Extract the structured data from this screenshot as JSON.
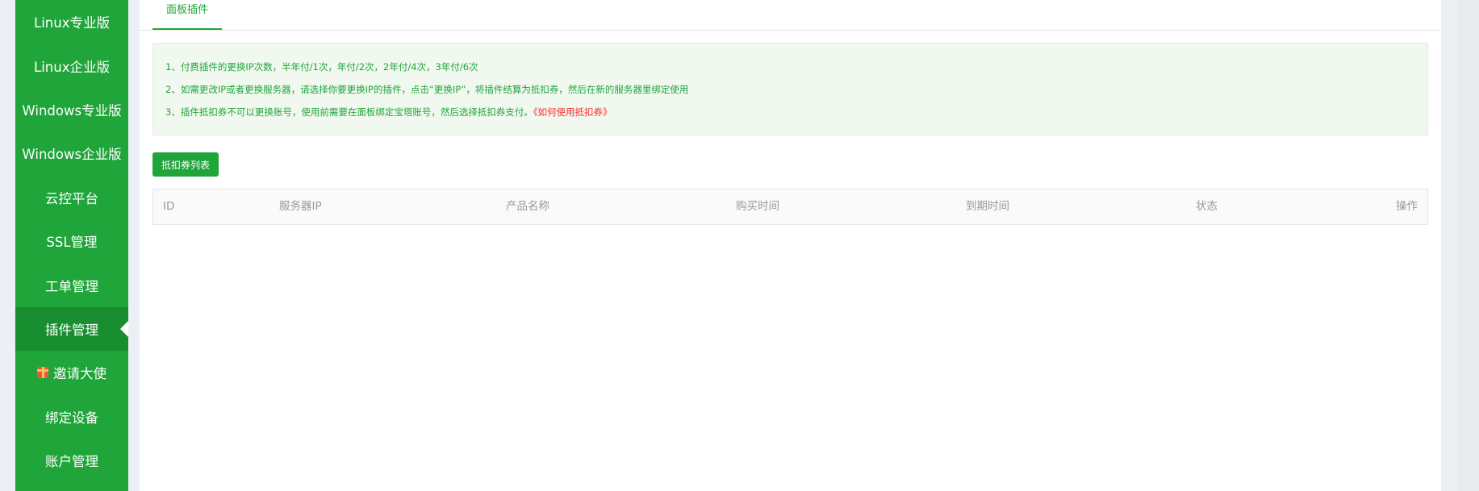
{
  "sidebar": {
    "items": [
      {
        "label": "Linux专业版"
      },
      {
        "label": "Linux企业版"
      },
      {
        "label": "Windows专业版"
      },
      {
        "label": "Windows企业版"
      },
      {
        "label": "云控平台"
      },
      {
        "label": "SSL管理"
      },
      {
        "label": "工单管理"
      },
      {
        "label": "插件管理",
        "active": true
      },
      {
        "label": "邀请大使",
        "icon": "gift-icon"
      },
      {
        "label": "绑定设备"
      },
      {
        "label": "账户管理"
      }
    ]
  },
  "main": {
    "tabs": [
      {
        "label": "面板插件",
        "active": true
      }
    ],
    "notice": {
      "lines": [
        "1、付费插件的更换IP次数，半年付/1次，年付/2次，2年付/4次，3年付/6次",
        "2、如需更改IP或者更换服务器，请选择你要更换IP的插件，点击“更换IP”，将插件结算为抵扣券，然后在新的服务器里绑定使用",
        "3、插件抵扣券不可以更换账号，使用前需要在面板绑定宝塔账号，然后选择抵扣券支付。"
      ],
      "link": "《如何使用抵扣券》"
    },
    "coupon_button": "抵扣券列表",
    "table": {
      "columns": [
        "ID",
        "服务器IP",
        "产品名称",
        "购买时间",
        "到期时间",
        "状态",
        "操作"
      ],
      "rows": []
    }
  },
  "colors": {
    "brand_green": "#20a53a",
    "active_green": "#188e31",
    "notice_bg": "#f1f8f0",
    "link_red": "#ff2a2a"
  }
}
